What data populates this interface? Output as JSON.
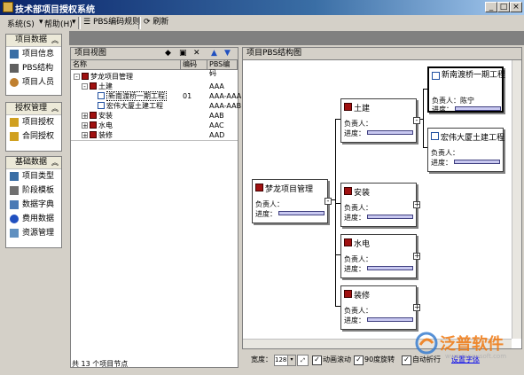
{
  "window": {
    "title": "技术部项目授权系统",
    "min": "_",
    "max": "□",
    "close": "×"
  },
  "menu": {
    "system": "系统(S)",
    "help": "帮助(H)",
    "pbs_rule": "PBS编码规则",
    "refresh": "刷新"
  },
  "nav": {
    "groups": [
      {
        "title": "项目数据",
        "items": [
          "项目信息",
          "PBS结构",
          "项目人员"
        ]
      },
      {
        "title": "授权管理",
        "items": [
          "项目授权",
          "合同授权"
        ]
      },
      {
        "title": "基础数据",
        "items": [
          "项目类型",
          "阶段模板",
          "数据字典",
          "费用数据",
          "资源管理"
        ]
      }
    ]
  },
  "project_view": {
    "title": "项目视图",
    "columns": [
      "名称",
      "编码",
      "PBS编码"
    ],
    "rows": [
      {
        "name": "梦龙项目管理",
        "code": "",
        "pbs": ""
      },
      {
        "name": "土建",
        "code": "",
        "pbs": "AAA"
      },
      {
        "name": "新南渡桥一期工程",
        "code": "01",
        "pbs": "AAA-AAA"
      },
      {
        "name": "宏伟大厦土建工程",
        "code": "",
        "pbs": "AAA-AAB"
      },
      {
        "name": "安装",
        "code": "",
        "pbs": "AAB"
      },
      {
        "name": "水电",
        "code": "",
        "pbs": "AAC"
      },
      {
        "name": "装修",
        "code": "",
        "pbs": "AAD"
      }
    ],
    "status": "共 13 个项目节点"
  },
  "pbs": {
    "title": "项目PBS结构图",
    "owner_label": "负责人：",
    "progress_label": "进度：",
    "nodes": {
      "root": {
        "title": "梦龙项目管理",
        "owner": ""
      },
      "tujian": {
        "title": "土建",
        "owner": ""
      },
      "anzhuang": {
        "title": "安装",
        "owner": ""
      },
      "shuidian": {
        "title": "水电",
        "owner": ""
      },
      "zhuangxiu": {
        "title": "装修",
        "owner": ""
      },
      "xinnan": {
        "title": "新南渡桥一期工程",
        "owner": "陈宁"
      },
      "hongwei": {
        "title": "宏伟大厦土建工程",
        "owner": ""
      }
    },
    "progress": {
      "root": 0,
      "tujian": 0,
      "anzhuang": 0,
      "shuidian": 0,
      "zhuangxiu": 0,
      "xinnan": 0,
      "hongwei": 0
    }
  },
  "bottom": {
    "width_label": "宽度：",
    "width_value": "128",
    "opt_scroll": "动画滚动",
    "opt_rotate": "90度旋转",
    "opt_auto": "自动折行",
    "link": "设置字体"
  },
  "logo": {
    "text": "泛普软件",
    "url": "www.fanpusoft.com"
  },
  "colors": {
    "titlebar": "#0a246a",
    "accent": "#f07810",
    "progress": "#c8c8f0"
  }
}
